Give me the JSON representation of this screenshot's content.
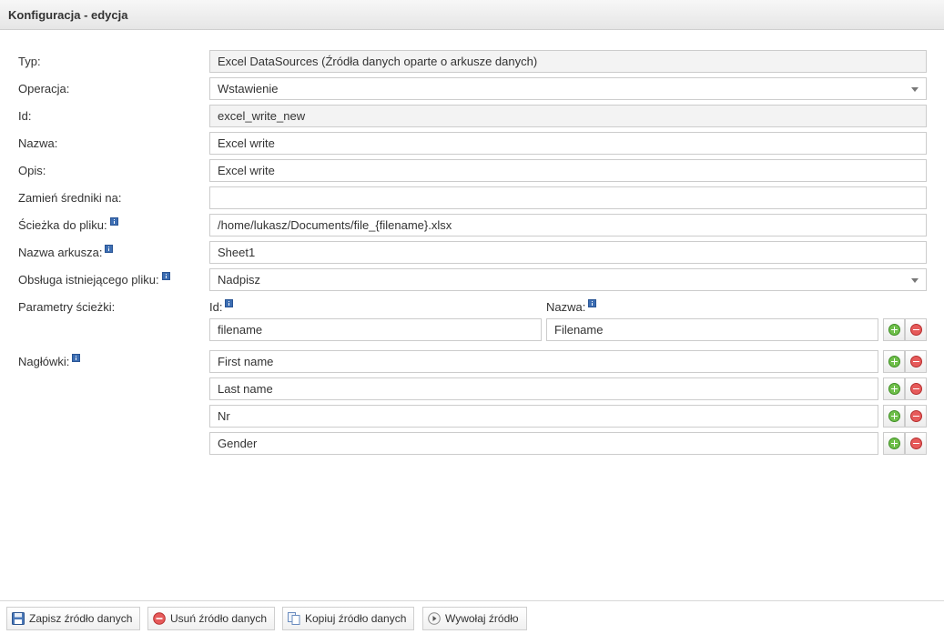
{
  "header": {
    "title": "Konfiguracja - edycja"
  },
  "form": {
    "typ": {
      "label": "Typ:",
      "value": "Excel DataSources (Źródła danych oparte o arkusze danych)"
    },
    "operacja": {
      "label": "Operacja:",
      "value": "Wstawienie"
    },
    "id": {
      "label": "Id:",
      "value": "excel_write_new"
    },
    "nazwa": {
      "label": "Nazwa:",
      "value": "Excel write"
    },
    "opis": {
      "label": "Opis:",
      "value": "Excel write"
    },
    "zamien": {
      "label": "Zamień średniki na:",
      "value": ""
    },
    "sciezka": {
      "label": "Ścieżka do pliku:",
      "value": "/home/lukasz/Documents/file_{filename}.xlsx"
    },
    "arkusz": {
      "label": "Nazwa arkusza:",
      "value": "Sheet1"
    },
    "obsluga": {
      "label": "Obsługa istniejącego pliku:",
      "value": "Nadpisz"
    },
    "parametry": {
      "label": "Parametry ścieżki:",
      "id_label": "Id:",
      "nazwa_label": "Nazwa:",
      "rows": [
        {
          "id": "filename",
          "nazwa": "Filename"
        }
      ]
    },
    "naglowki": {
      "label": "Nagłówki:",
      "items": [
        "First name",
        "Last name",
        "Nr",
        "Gender"
      ]
    }
  },
  "footer": {
    "save": "Zapisz źródło danych",
    "delete": "Usuń źródło danych",
    "copy": "Kopiuj źródło danych",
    "invoke": "Wywołaj źródło"
  },
  "icons": {
    "info": "info-icon",
    "add": "plus-circle-icon",
    "remove": "minus-circle-icon",
    "save": "floppy-disk-icon",
    "delete": "no-entry-icon",
    "copy": "copy-documents-icon",
    "invoke": "play-icon"
  },
  "colors": {
    "add_button": "#6fbf4a",
    "remove_button": "#e65a5a",
    "info_icon": "#3d6eb3",
    "readonly_field": "#f3f3f3"
  }
}
